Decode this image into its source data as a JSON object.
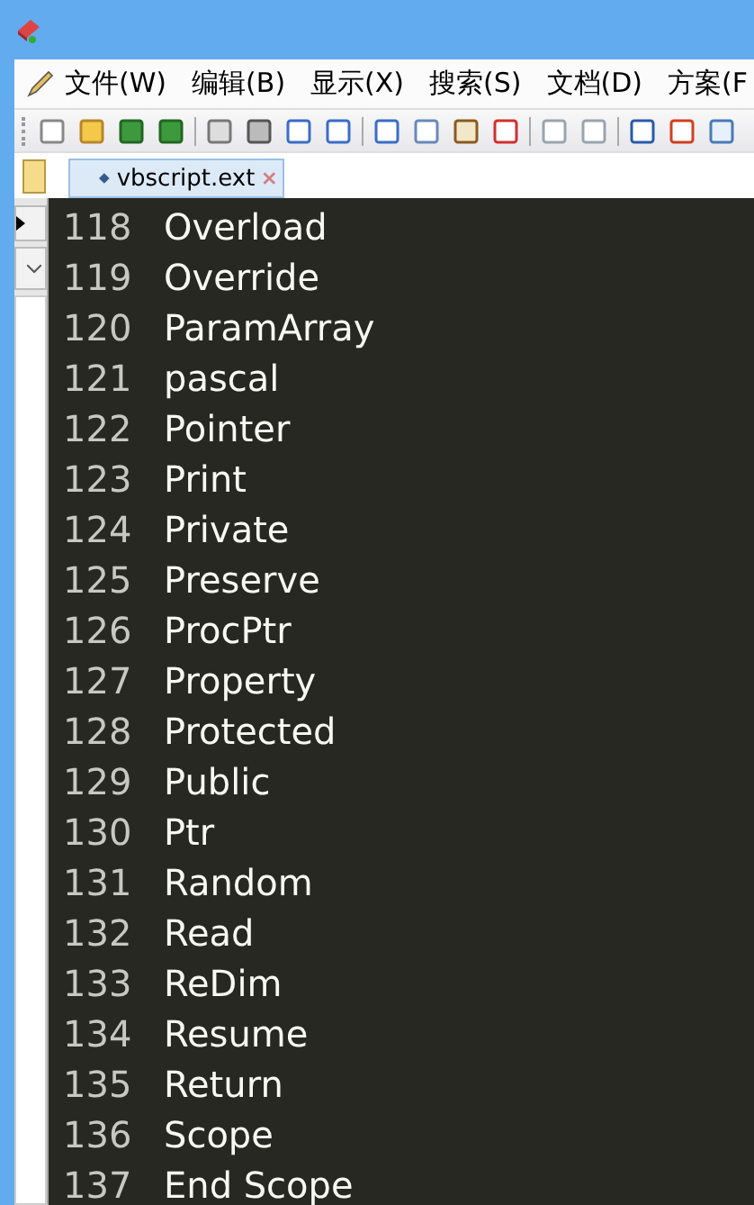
{
  "menu": [
    {
      "label": "文件(W)"
    },
    {
      "label": "编辑(B)"
    },
    {
      "label": "显示(X)"
    },
    {
      "label": "搜索(S)"
    },
    {
      "label": "文档(D)"
    },
    {
      "label": "方案(F"
    }
  ],
  "tabs": [
    {
      "label": "vbscript.ext",
      "selected": true
    }
  ],
  "lines": [
    {
      "number": "118",
      "text": "Overload"
    },
    {
      "number": "119",
      "text": "Override"
    },
    {
      "number": "120",
      "text": "ParamArray"
    },
    {
      "number": "121",
      "text": "pascal"
    },
    {
      "number": "122",
      "text": "Pointer"
    },
    {
      "number": "123",
      "text": "Print"
    },
    {
      "number": "124",
      "text": "Private"
    },
    {
      "number": "125",
      "text": "Preserve"
    },
    {
      "number": "126",
      "text": "ProcPtr"
    },
    {
      "number": "127",
      "text": "Property"
    },
    {
      "number": "128",
      "text": "Protected"
    },
    {
      "number": "129",
      "text": "Public"
    },
    {
      "number": "130",
      "text": "Ptr"
    },
    {
      "number": "131",
      "text": "Random"
    },
    {
      "number": "132",
      "text": "Read"
    },
    {
      "number": "133",
      "text": "ReDim"
    },
    {
      "number": "134",
      "text": "Resume"
    },
    {
      "number": "135",
      "text": "Return"
    },
    {
      "number": "136",
      "text": "Scope"
    },
    {
      "number": "137",
      "text": "End Scope"
    }
  ]
}
